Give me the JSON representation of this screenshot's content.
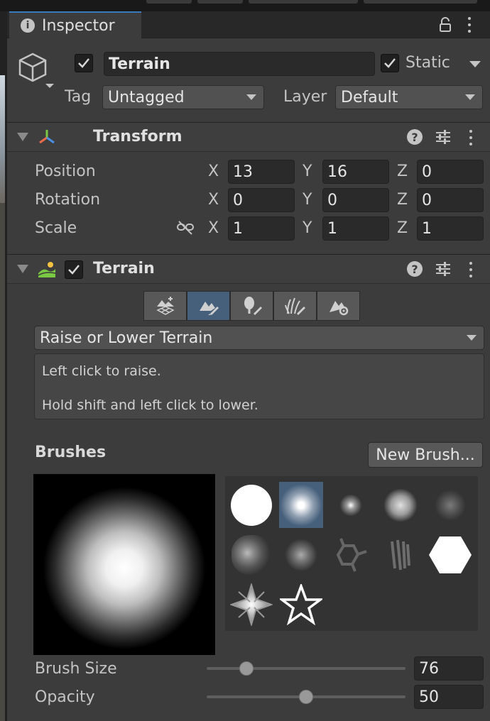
{
  "tab": {
    "title": "Inspector"
  },
  "object": {
    "name": "Terrain",
    "active": true,
    "static_label": "Static",
    "static": true
  },
  "tag": {
    "label": "Tag",
    "value": "Untagged"
  },
  "layer": {
    "label": "Layer",
    "value": "Default"
  },
  "transform": {
    "title": "Transform",
    "rows": [
      {
        "label": "Position",
        "x": "13",
        "y": "16",
        "z": "0"
      },
      {
        "label": "Rotation",
        "x": "0",
        "y": "0",
        "z": "0"
      },
      {
        "label": "Scale",
        "x": "1",
        "y": "1",
        "z": "1"
      }
    ],
    "axis": {
      "x": "X",
      "y": "Y",
      "z": "Z"
    }
  },
  "terrain": {
    "title": "Terrain",
    "enabled": true,
    "tools": [
      "create-neighbor-terrains-icon",
      "paint-terrain-icon",
      "paint-trees-icon",
      "paint-details-icon",
      "terrain-settings-icon"
    ],
    "active_tool": 1,
    "mode": "Raise or Lower Terrain",
    "help_line1": "Left click to raise.",
    "help_line2": "Hold shift and left click to lower.",
    "brushes_label": "Brushes",
    "new_brush_label": "New Brush...",
    "selected_brush": 1,
    "brush_size_label": "Brush Size",
    "brush_size": "76",
    "brush_size_fraction": 0.2,
    "opacity_label": "Opacity",
    "opacity": "50",
    "opacity_fraction": 0.5
  },
  "colors": {
    "accent": "#3a79bb",
    "selection": "#46607c",
    "panel": "#3c3c3c"
  }
}
